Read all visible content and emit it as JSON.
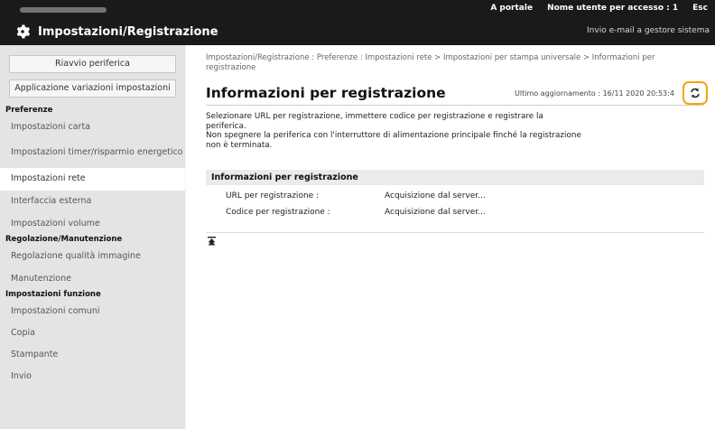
{
  "header": {
    "portal_link": "A portale",
    "user_label": "Nome utente per accesso :",
    "user_value": "1",
    "logout": "Esc",
    "app_title": "Impostazioni/Registrazione",
    "email_link": "Invio e-mail a gestore sistema"
  },
  "sidebar": {
    "restart_button": "Riavvio periferica",
    "apply_button": "Applicazione variazioni impostazioni",
    "sections": [
      {
        "title": "Preferenze",
        "items": [
          "Impostazioni carta",
          "Impostazioni timer/risparmio energetico",
          "Impostazioni rete",
          "Interfaccia esterna",
          "Impostazioni volume"
        ]
      },
      {
        "title": "Regolazione/Manutenzione",
        "items": [
          "Regolazione qualità immagine",
          "Manutenzione"
        ]
      },
      {
        "title": "Impostazioni funzione",
        "items": [
          "Impostazioni comuni",
          "Copia",
          "Stampante",
          "Invio"
        ]
      }
    ]
  },
  "main": {
    "breadcrumb": "Impostazioni/Registrazione : Preferenze : Impostazioni rete > Impostazioni per stampa universale > Informazioni per registrazione",
    "title": "Informazioni per registrazione",
    "updated": "Ultimo aggiornamento : 16/11 2020 20:53:4",
    "desc_line1": "Selezionare URL per registrazione, immettere codice per registrazione e registrare la periferica.",
    "desc_line2": "Non spegnere la periferica con l'interruttore di alimentazione principale finché la registrazione non è terminata.",
    "panel": {
      "title": "Informazioni per registrazione",
      "rows": [
        {
          "label": "URL per registrazione :",
          "value": "Acquisizione dal server..."
        },
        {
          "label": "Codice per registrazione :",
          "value": "Acquisizione dal server..."
        }
      ]
    }
  },
  "colors": {
    "topbar": "#1a1a1a",
    "sidebar": "#e4e4e4",
    "highlight": "#f5a500"
  },
  "icons": {
    "settings": "gear-icon",
    "refresh": "refresh-icon",
    "top": "scroll-top-icon"
  }
}
